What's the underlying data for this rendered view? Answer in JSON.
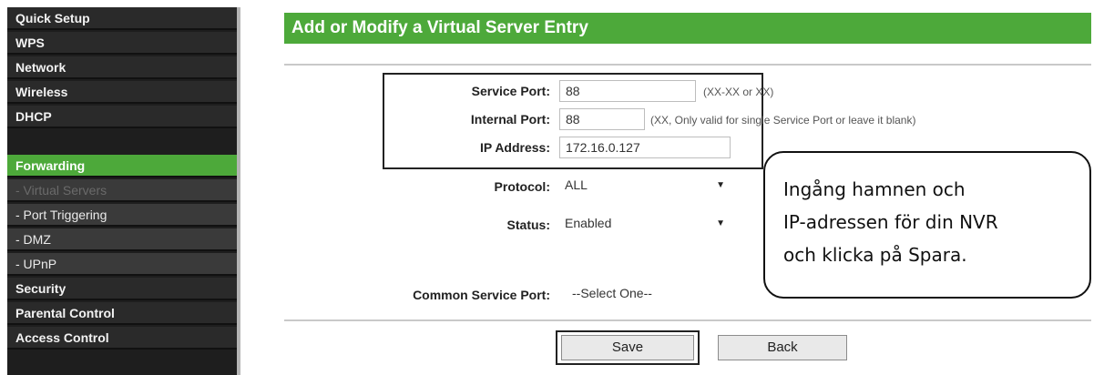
{
  "sidebar": {
    "items": [
      {
        "label": "Quick Setup"
      },
      {
        "label": "WPS"
      },
      {
        "label": "Network"
      },
      {
        "label": "Wireless"
      },
      {
        "label": "DHCP"
      },
      {
        "label": "Forwarding"
      },
      {
        "label": "- Virtual Servers"
      },
      {
        "label": "- Port Triggering"
      },
      {
        "label": "- DMZ"
      },
      {
        "label": "- UPnP"
      },
      {
        "label": "Security"
      },
      {
        "label": "Parental Control"
      },
      {
        "label": "Access Control"
      }
    ],
    "active_color": "#4da93a"
  },
  "main": {
    "title": "Add or Modify a Virtual Server Entry",
    "form": {
      "service_port": {
        "label": "Service Port:",
        "value": "88",
        "hint": "(XX-XX or XX)"
      },
      "internal_port": {
        "label": "Internal Port:",
        "value": "88",
        "hint": "(XX, Only valid for single Service Port or leave it blank)"
      },
      "ip_address": {
        "label": "IP Address:",
        "value": "172.16.0.127"
      },
      "protocol": {
        "label": "Protocol:",
        "value": "ALL"
      },
      "status": {
        "label": "Status:",
        "value": "Enabled"
      },
      "common_service_port": {
        "label": "Common Service Port:",
        "value": "--Select One--"
      }
    },
    "buttons": {
      "save": "Save",
      "back": "Back"
    }
  },
  "callout": {
    "lines": [
      "Ingång hamnen och",
      "IP-adressen för din NVR",
      "och klicka på Spara."
    ]
  }
}
